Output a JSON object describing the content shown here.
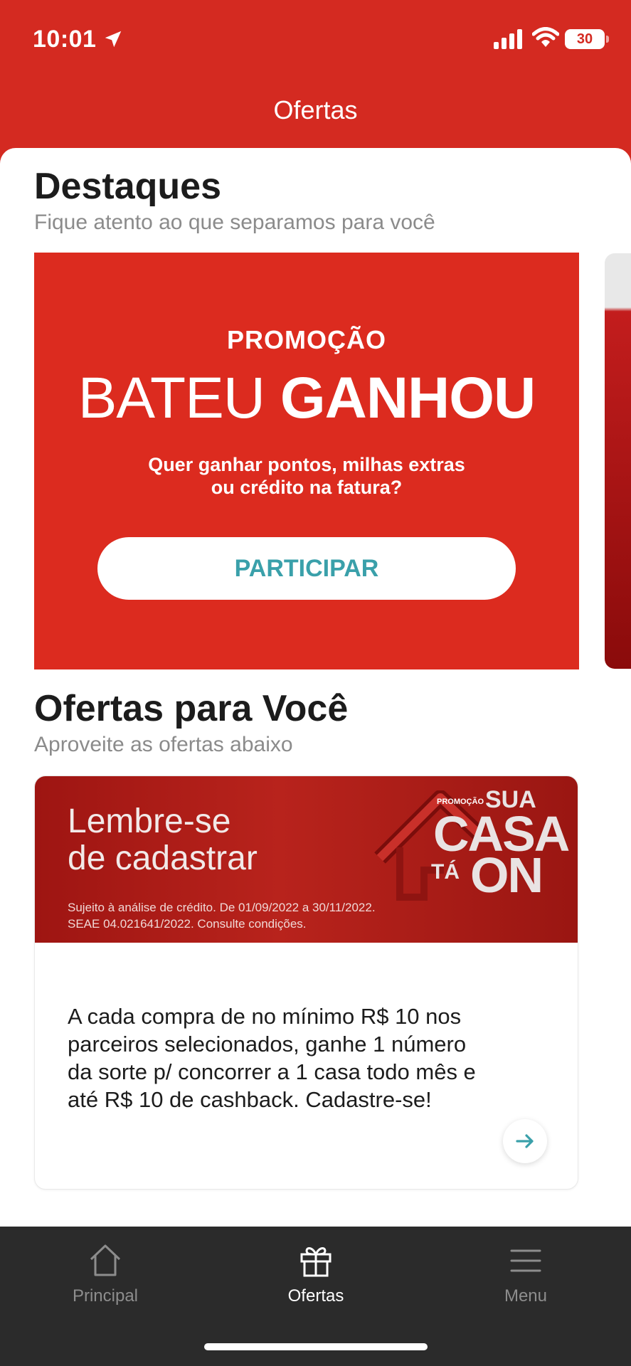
{
  "status_bar": {
    "time": "10:01",
    "battery": "30"
  },
  "nav": {
    "title": "Ofertas"
  },
  "highlights": {
    "title": "Destaques",
    "subtitle": "Fique atento ao que separamos para você",
    "banner": {
      "eyebrow": "PROMOÇÃO",
      "title_part1": "BATEU",
      "title_part2": "GANHOU",
      "text_line1": "Quer ganhar pontos, milhas extras",
      "text_line2": "ou crédito na fatura?",
      "cta": "PARTICIPAR"
    }
  },
  "offers": {
    "title": "Ofertas para Você",
    "subtitle": "Aproveite as ofertas abaixo",
    "card": {
      "banner_line1": "Lembre-se",
      "banner_line2": "de cadastrar",
      "legal_line1": "Sujeito à análise de crédito. De 01/09/2022 a 30/11/2022.",
      "legal_line2": "SEAE 04.021641/2022. Consulte condições.",
      "promo_small": "PROMOÇÃO",
      "promo_sua": "SUA",
      "promo_casa": "CASA",
      "promo_ta": "TÁ",
      "promo_on": "ON",
      "description": "A cada compra de no mínimo R$ 10 nos parceiros selecionados, ganhe 1 número da sorte p/ concorrer a 1 casa todo mês e até R$ 10 de cashback. Cadastre-se!"
    }
  },
  "tab_bar": {
    "tabs": [
      {
        "label": "Principal",
        "icon": "home-icon"
      },
      {
        "label": "Ofertas",
        "icon": "gift-icon"
      },
      {
        "label": "Menu",
        "icon": "menu-icon"
      }
    ],
    "active": "Ofertas"
  },
  "colors": {
    "brand_red": "#d42a21",
    "teal": "#3aa0aa",
    "tab_bg": "#2b2b2b"
  }
}
